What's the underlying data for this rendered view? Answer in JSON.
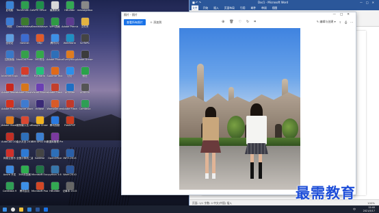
{
  "desktop": {
    "icons": [
      {
        "label": "此电脑",
        "color": "#3a84d6"
      },
      {
        "label": "TechSmith Camtasia",
        "color": "#2e9e4f"
      },
      {
        "label": "WPS Office",
        "color": "#1f8f4a"
      },
      {
        "label": "最需教育",
        "color": "#d8d8d8"
      },
      {
        "label": "HBuilder",
        "color": "#33a852"
      },
      {
        "label": "messageBox",
        "color": "#888888"
      },
      {
        "label": "网络",
        "color": "#3b7bd4"
      },
      {
        "label": "Dreamweaver",
        "color": "#3c7a2e"
      },
      {
        "label": "Dreamweaver",
        "color": "#34703a"
      },
      {
        "label": "WPS表格",
        "color": "#2f9a44"
      },
      {
        "label": "Adobe Premiere",
        "color": "#5c3a8f"
      },
      {
        "label": "文件夹",
        "color": "#e3b341"
      },
      {
        "label": "回收站",
        "color": "#5f9ee0"
      },
      {
        "label": "Navicat",
        "color": "#3c6bd0"
      },
      {
        "label": "Xftp",
        "color": "#e05a2a"
      },
      {
        "label": "腾讯QQ",
        "color": "#3d8fe6"
      },
      {
        "label": "WebStorm",
        "color": "#1f8fc2"
      },
      {
        "label": "ScrToPic",
        "color": "#444444"
      },
      {
        "label": "控制面板",
        "color": "#3978c8"
      },
      {
        "label": "NaviCat Premium",
        "color": "#36a04a"
      },
      {
        "label": "360安全",
        "color": "#35a84a"
      },
      {
        "label": "Adobe Photoshop",
        "color": "#2d6fb8"
      },
      {
        "label": "Everything",
        "color": "#de7c20"
      },
      {
        "label": "Adobe Dreamweaver",
        "color": "#3c3c3c"
      },
      {
        "label": "Internet Explorer",
        "color": "#2d83d8"
      },
      {
        "label": "XMind",
        "color": "#d63c2a"
      },
      {
        "label": "PyCharm",
        "color": "#23c07a"
      },
      {
        "label": "Sublime Text",
        "color": "#e06a1a"
      },
      {
        "label": "钉钉",
        "color": "#2d8ee8"
      },
      {
        "label": "微信",
        "color": "#2aa24a"
      },
      {
        "label": "Adobe Reader DC",
        "color": "#c7281e"
      },
      {
        "label": "Adobe Illustrator",
        "color": "#d6761c"
      },
      {
        "label": "Visual Studio",
        "color": "#6b3fb3"
      },
      {
        "label": "Adobe Flash",
        "color": "#c43f2d"
      },
      {
        "label": "ACDSee",
        "color": "#1f6fc3"
      },
      {
        "label": "AC6000",
        "color": "#555555"
      },
      {
        "label": "Adobe Flash Professional",
        "color": "#d3321f"
      },
      {
        "label": "VMware Workstation",
        "color": "#3f7bd0"
      },
      {
        "label": "eclipse",
        "color": "#3a2a76"
      },
      {
        "label": "WampServer",
        "color": "#d85b28"
      },
      {
        "label": "Adobe Flash",
        "color": "#c0392b"
      },
      {
        "label": "Camtasia",
        "color": "#2f9e55"
      },
      {
        "label": "Adobe Illustrator",
        "color": "#e07a1c"
      },
      {
        "label": "搜狗输入法 v8.2.2",
        "color": "#d94832"
      },
      {
        "label": "Google Chrome",
        "color": "#f2b320"
      },
      {
        "label": "腾讯视频",
        "color": "#2a7ae0"
      },
      {
        "label": "FlashFXP",
        "color": "#c93b1f"
      },
      {
        "label": "",
        "color": "#000000"
      },
      {
        "label": "AutoCAD 2008",
        "color": "#c12f25"
      },
      {
        "label": "会计从业 2010",
        "color": "#2e6fb8"
      },
      {
        "label": "IBM SPSS Statistics 20",
        "color": "#3c7fd0"
      },
      {
        "label": "数据库管理 Premier",
        "color": "#7a3a9e"
      },
      {
        "label": "",
        "color": "#000000"
      },
      {
        "label": "",
        "color": "#000000"
      },
      {
        "label": "网易云音乐",
        "color": "#d0302a"
      },
      {
        "label": "全国计算机二级",
        "color": "#2e7ad4"
      },
      {
        "label": "Sublime",
        "color": "#444444"
      },
      {
        "label": "OpenOffice",
        "color": "#2d6fb8"
      },
      {
        "label": "INFO-2013",
        "color": "#2a5fa8"
      },
      {
        "label": "",
        "color": "#000000"
      },
      {
        "label": "Azure 开发",
        "color": "#3d88dd"
      },
      {
        "label": "360浏览器",
        "color": "#2fae4f"
      },
      {
        "label": "Microsoft Excel 2016",
        "color": "#217346"
      },
      {
        "label": "python 3.6",
        "color": "#3776ab"
      },
      {
        "label": "Word 2010",
        "color": "#2b579a"
      },
      {
        "label": "",
        "color": "#000000"
      },
      {
        "label": "Camtasia 9",
        "color": "#2f9e55"
      },
      {
        "label": "腾讯会议",
        "color": "#3d8fe6"
      },
      {
        "label": "Microsoft PowerPoint",
        "color": "#d24726"
      },
      {
        "label": "HBuilder",
        "color": "#33a852"
      },
      {
        "label": "记事本 2015",
        "color": "#666666"
      },
      {
        "label": "",
        "color": "#000000"
      }
    ]
  },
  "word": {
    "title": "Doc1 - Microsoft Word",
    "file_tab": "文件",
    "tabs": [
      "开始",
      "插入",
      "页面布局",
      "引用",
      "邮件",
      "审阅",
      "视图"
    ],
    "status": "页面: 1/1   字数: 0   中文(中国)   插入",
    "zoom": "100%"
  },
  "photos": {
    "title": "照片 - 照片",
    "edit_create": "查看所有照片",
    "add_to": "添加到",
    "tool_icons": [
      "放大",
      "删除",
      "收藏",
      "旋转",
      "裁剪"
    ],
    "edit_label": "编辑与创建",
    "share_icon": "共享",
    "print_icon": "打印",
    "more_icon": "更多"
  },
  "taskbar": {
    "time": "12:40",
    "date": "2021/5/17",
    "lang": "中"
  },
  "watermark": "最需教育"
}
